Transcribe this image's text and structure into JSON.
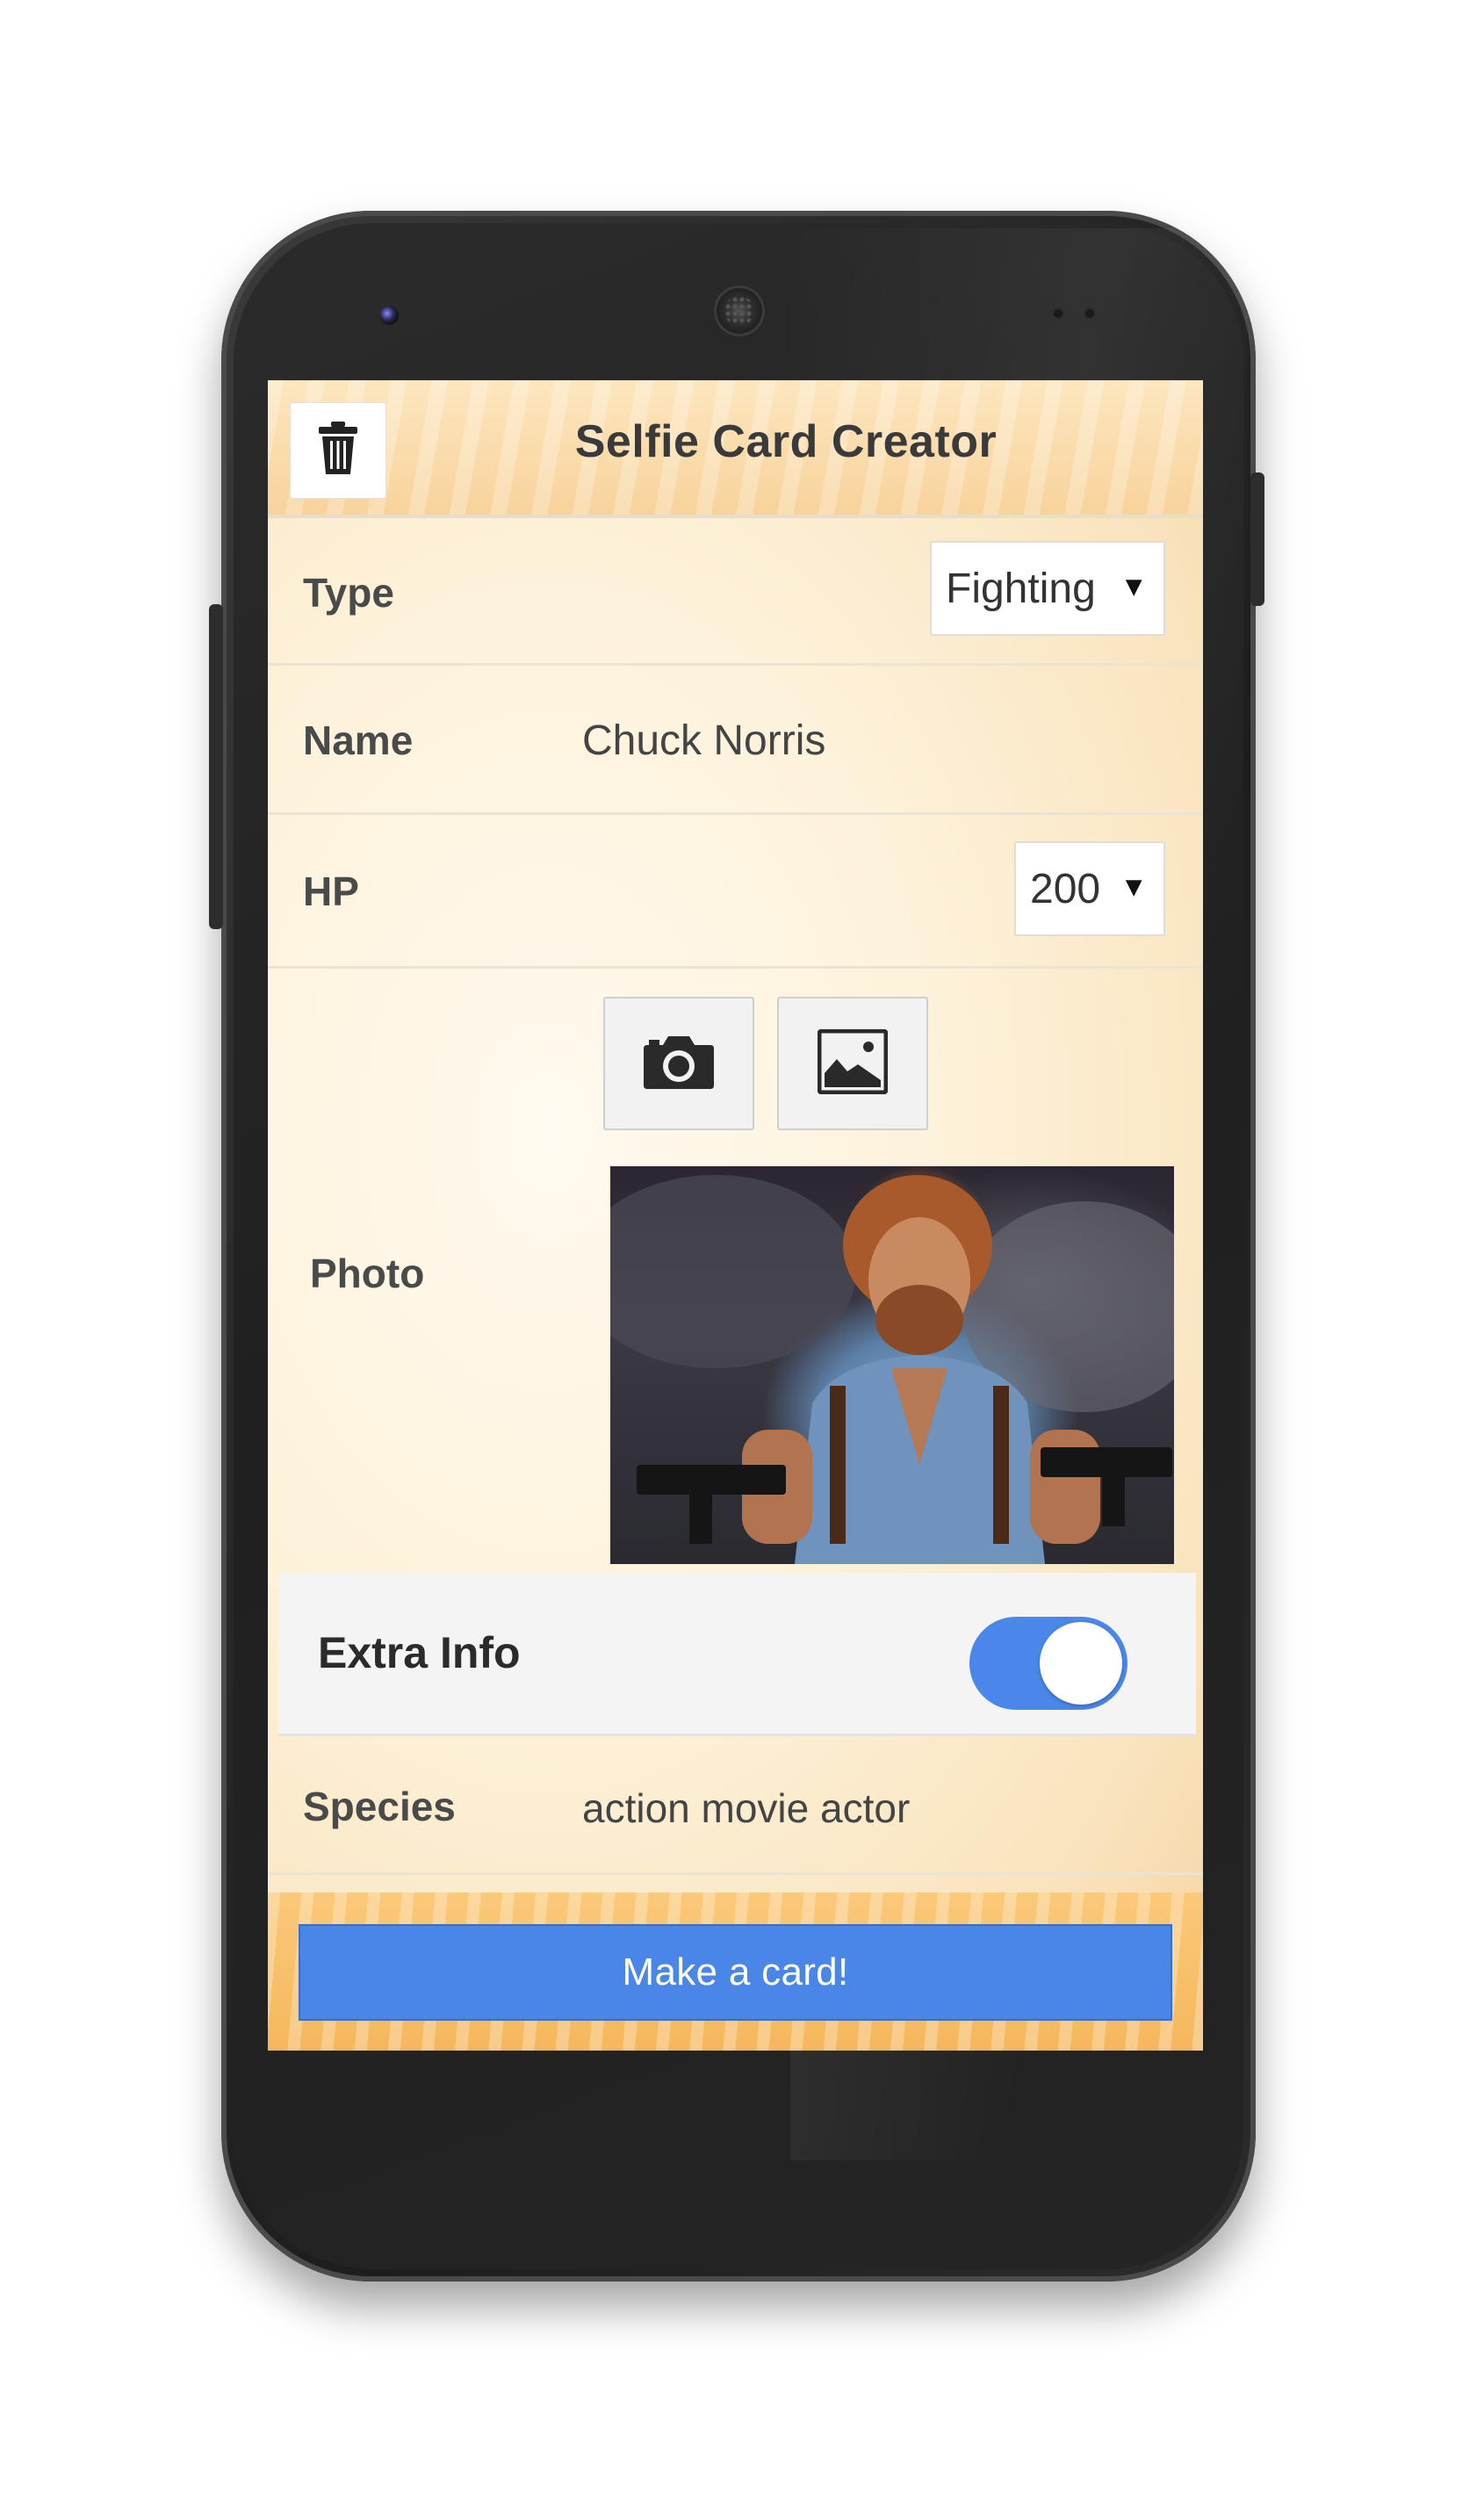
{
  "app": {
    "title": "Selfie Card Creator",
    "icons": {
      "trash": "trash-icon",
      "camera": "camera-icon",
      "gallery": "image-gallery-icon"
    }
  },
  "form": {
    "type": {
      "label": "Type",
      "value": "Fighting"
    },
    "name": {
      "label": "Name",
      "value": "Chuck Norris"
    },
    "hp": {
      "label": "HP",
      "value": "200"
    },
    "photo": {
      "label": "Photo"
    },
    "extra_info": {
      "label": "Extra Info",
      "enabled": true
    },
    "species": {
      "label": "Species",
      "value": "action movie actor"
    }
  },
  "actions": {
    "make_card_label": "Make a card!"
  },
  "colors": {
    "accent": "#4a86e8",
    "toggle_on": "#4b87ea",
    "header_bg": "#f8d39b",
    "phone_body": "#262626"
  }
}
